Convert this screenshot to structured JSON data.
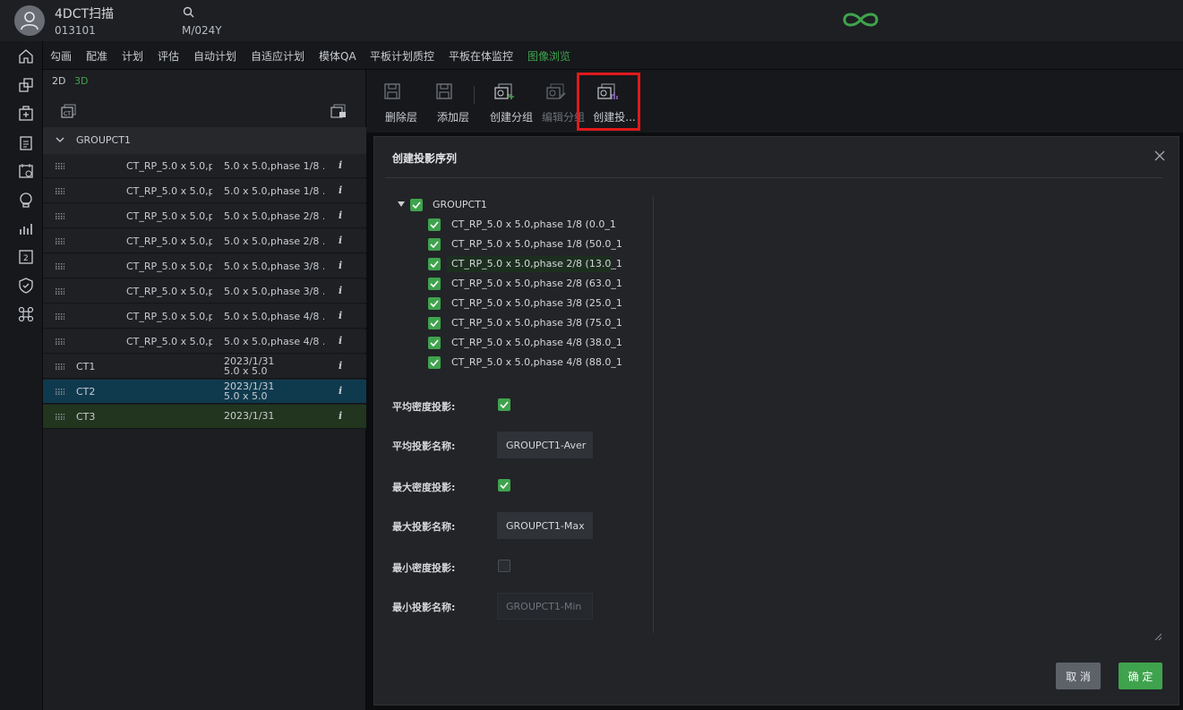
{
  "header": {
    "patient_name": "4DCT扫描",
    "patient_id": "013101",
    "patient_sex_age": "M/024Y"
  },
  "tabs": [
    {
      "label": "勾画"
    },
    {
      "label": "配准"
    },
    {
      "label": "计划"
    },
    {
      "label": "评估"
    },
    {
      "label": "自动计划"
    },
    {
      "label": "自适应计划"
    },
    {
      "label": "模体QA"
    },
    {
      "label": "平板计划质控"
    },
    {
      "label": "平板在体监控"
    },
    {
      "label": "图像浏览",
      "active": true
    }
  ],
  "left_panel": {
    "view_2d": "2D",
    "view_3d": "3D",
    "group_name": "GROUPCT1",
    "series": [
      {
        "name": "CT_RP_5.0 x 5.0,ph",
        "desc": "5.0 x 5.0,phase 1/8 ..."
      },
      {
        "name": "CT_RP_5.0 x 5.0,ph",
        "desc": "5.0 x 5.0,phase 1/8 ..."
      },
      {
        "name": "CT_RP_5.0 x 5.0,ph",
        "desc": "5.0 x 5.0,phase 2/8 ..."
      },
      {
        "name": "CT_RP_5.0 x 5.0,ph",
        "desc": "5.0 x 5.0,phase 2/8 ..."
      },
      {
        "name": "CT_RP_5.0 x 5.0,ph",
        "desc": "5.0 x 5.0,phase 3/8 ..."
      },
      {
        "name": "CT_RP_5.0 x 5.0,ph",
        "desc": "5.0 x 5.0,phase 3/8 ..."
      },
      {
        "name": "CT_RP_5.0 x 5.0,ph",
        "desc": "5.0 x 5.0,phase 4/8 ..."
      },
      {
        "name": "CT_RP_5.0 x 5.0,ph",
        "desc": "5.0 x 5.0,phase 4/8 ..."
      }
    ],
    "info_glyph": "i",
    "ct_items": [
      {
        "name": "CT1",
        "date": "2023/1/31",
        "size": "5.0 x 5.0"
      },
      {
        "name": "CT2",
        "date": "2023/1/31",
        "size": "5.0 x 5.0"
      },
      {
        "name": "CT3",
        "date": "2023/1/31"
      }
    ]
  },
  "toolbar": {
    "delete_layer": "删除层",
    "add_layer": "添加层",
    "create_group": "创建分组",
    "edit_group": "编辑分组",
    "create_projection": "创建投..."
  },
  "dialog": {
    "title": "创建投影序列",
    "tree_root": "GROUPCT1",
    "tree_items": [
      "CT_RP_5.0 x 5.0,phase 1/8 (0.0_1",
      "CT_RP_5.0 x 5.0,phase 1/8 (50.0_1",
      "CT_RP_5.0 x 5.0,phase 2/8 (13.0_1",
      "CT_RP_5.0 x 5.0,phase 2/8 (63.0_1",
      "CT_RP_5.0 x 5.0,phase 3/8 (25.0_1",
      "CT_RP_5.0 x 5.0,phase 3/8 (75.0_1",
      "CT_RP_5.0 x 5.0,phase 4/8 (38.0_1",
      "CT_RP_5.0 x 5.0,phase 4/8 (88.0_1"
    ],
    "avg_density_label": "平均密度投影:",
    "avg_density_checked": true,
    "avg_name_label": "平均投影名称:",
    "avg_name_value": "GROUPCT1-Aver",
    "max_density_label": "最大密度投影:",
    "max_density_checked": true,
    "max_name_label": "最大投影名称:",
    "max_name_value": "GROUPCT1-Max",
    "min_density_label": "最小密度投影:",
    "min_density_checked": false,
    "min_name_label": "最小投影名称:",
    "min_name_value": "GROUPCT1-Min",
    "cancel": "取 消",
    "ok": "确 定"
  },
  "colors": {
    "accent": "#3fa34d",
    "highlight": "#e0191c",
    "selected_blue": "#0f3a4e",
    "selected_green": "#22351f"
  }
}
